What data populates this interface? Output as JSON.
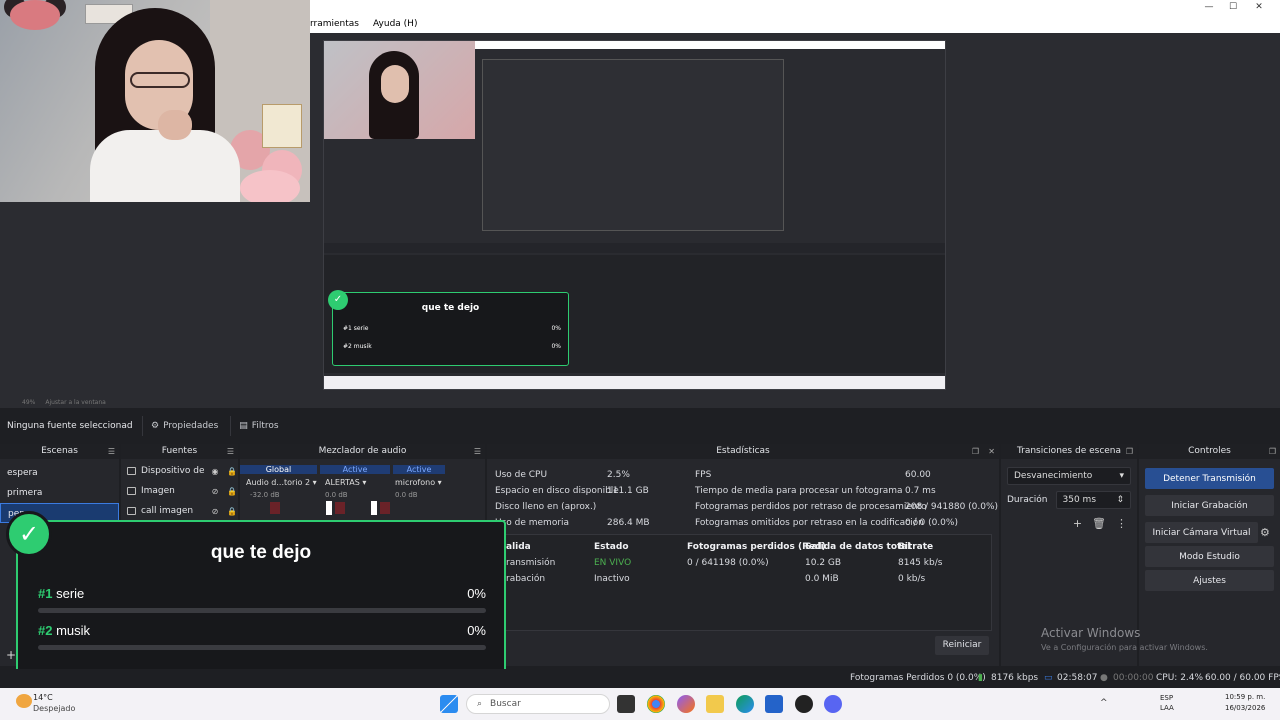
{
  "menu": {
    "items": [
      "rramientas",
      "Ayuda (H)"
    ]
  },
  "window_controls": [
    "—",
    "☐",
    "✕"
  ],
  "preview": {
    "zoom": "49%",
    "fit_label": "Ajustar a la ventana",
    "mini_alert": {
      "title": "que te dejo",
      "rows": [
        {
          "rank": "#1",
          "name": "serie",
          "pct": "0%"
        },
        {
          "rank": "#2",
          "name": "musik",
          "pct": "0%"
        }
      ]
    }
  },
  "context": {
    "no_source": "Ninguna fuente seleccionad",
    "properties": "Propiedades",
    "filters": "Filtros"
  },
  "scenes": {
    "title": "Escenas",
    "items": [
      "espera",
      "primera",
      "pen"
    ]
  },
  "sources": {
    "title": "Fuentes",
    "items": [
      "Dispositivo de",
      "Imagen",
      "call imagen"
    ]
  },
  "mixer": {
    "title": "Mezclador de audio",
    "tabs": [
      "Global",
      "Active",
      "Active"
    ],
    "channels": [
      "Audio d...torio 2",
      "ALERTAS",
      "microfono"
    ],
    "levels": [
      "-32.0 dB",
      "0.0 dB",
      "0.0 dB"
    ]
  },
  "stats": {
    "title": "Estadísticas",
    "left": [
      {
        "label": "Uso de CPU",
        "value": "2.5%"
      },
      {
        "label": "Espacio en disco disponible",
        "value": "111.1 GB"
      },
      {
        "label": "Disco lleno en (aprox.)",
        "value": ""
      },
      {
        "label": "Uso de memoria",
        "value": "286.4 MB"
      }
    ],
    "right": [
      {
        "label": "FPS",
        "value": "60.00"
      },
      {
        "label": "Tiempo de media para procesar un fotograma",
        "value": "0.7 ms"
      },
      {
        "label": "Fotogramas perdidos por retraso de procesamiento",
        "value": "208 / 941880 (0.0%)"
      },
      {
        "label": "Fotogramas omitidos por retraso en la codificación",
        "value": "0 / 0 (0.0%)"
      }
    ],
    "table_headers": [
      "alida",
      "Estado",
      "Fotogramas perdidos (Red)",
      "Salida de datos total",
      "Bitrate"
    ],
    "rows": [
      [
        "ransmisión",
        "EN VIVO",
        "0 / 641198 (0.0%)",
        "10.2 GB",
        "8145 kb/s"
      ],
      [
        "rabación",
        "Inactivo",
        "",
        "0.0 MiB",
        "0 kb/s"
      ]
    ],
    "reset": "Reiniciar"
  },
  "transitions": {
    "title": "Transiciones de escena",
    "selected": "Desvanecimiento",
    "duration_label": "Duración",
    "duration_value": "350 ms"
  },
  "controls": {
    "title": "Controles",
    "buttons": [
      "Detener Transmisión",
      "Iniciar Grabación",
      "Iniciar Cámara Virtual",
      "Modo Estudio",
      "Ajustes"
    ]
  },
  "alert": {
    "title": "que te dejo",
    "rows": [
      {
        "rank": "#1",
        "name": "serie",
        "pct": "0%"
      },
      {
        "rank": "#2",
        "name": "musik",
        "pct": "0%"
      }
    ]
  },
  "watermark": {
    "title": "Activar Windows",
    "subtitle": "Ve a Configuración para activar Windows."
  },
  "statusbar": {
    "dropped": "Fotogramas Perdidos 0 (0.0%)",
    "bitrate": "8176 kbps",
    "live_time": "02:58:07",
    "rec_time": "00:00:00",
    "cpu": "CPU: 2.4%",
    "fps": "60.00 / 60.00 FPS"
  },
  "taskbar": {
    "weather_temp": "14°C",
    "weather_desc": "Despejado",
    "search_placeholder": "Buscar",
    "lang1": "ESP",
    "lang2": "LAA",
    "time": "10:59 p. m.",
    "date": "16/03/2026"
  },
  "colors": {
    "accent": "#2ecc71",
    "primary_button": "#284f93",
    "selection": "#1a3b70"
  }
}
